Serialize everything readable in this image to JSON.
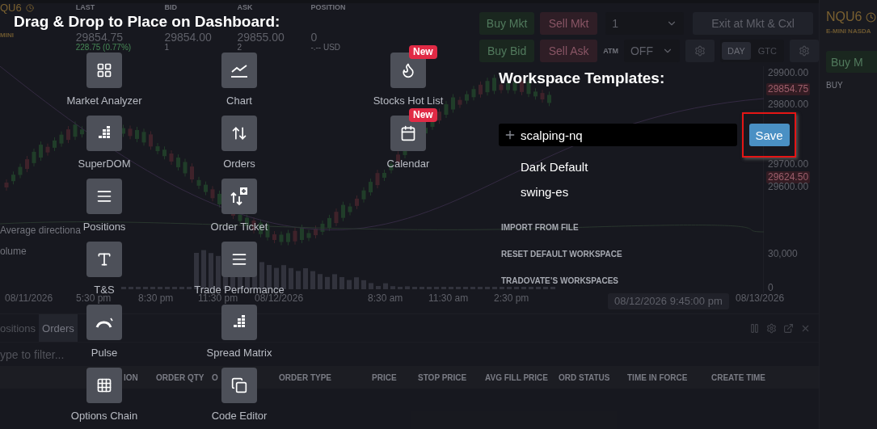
{
  "quote": {
    "symbol": "QU6",
    "subtitle": "MINI",
    "fields": [
      {
        "label": "LAST",
        "value": "29854.75",
        "change": "228.75 (0.77%)",
        "rising": true
      },
      {
        "label": "BID",
        "value": "29854.00",
        "change": "1",
        "rising": false
      },
      {
        "label": "ASK",
        "value": "29855.00",
        "change": "2",
        "rising": false
      },
      {
        "label": "POSITION",
        "value": "0",
        "change": "-.-- USD",
        "rising": false
      }
    ]
  },
  "order_bar": {
    "buy_market": "Buy Mkt",
    "sell_market": "Sell Mkt",
    "quantity": "1",
    "exit": "Exit at Mkt & Cxl",
    "buy_bid": "Buy Bid",
    "sell_ask": "Sell Ask",
    "atm_label": "ATM",
    "atm_value": "OFF",
    "time_in_force": [
      {
        "label": "DAY",
        "selected": true
      },
      {
        "label": "GTC",
        "selected": false
      }
    ]
  },
  "right_panel": {
    "symbol": "NQU6",
    "subtitle": "E-MINI NASDA",
    "buy_button": "Buy M",
    "column": "BUY"
  },
  "chart": {
    "indicator_labels": [
      "Average directiona",
      "olume"
    ],
    "y_labels": [
      {
        "text": "29900.00",
        "kind": "tick"
      },
      {
        "text": "29854.75",
        "kind": "marker"
      },
      {
        "text": "29800.00",
        "kind": "tick"
      },
      {
        "text": "29700.00",
        "kind": "tick"
      },
      {
        "text": "29624.50",
        "kind": "marker"
      },
      {
        "text": "29600.00",
        "kind": "tick"
      },
      {
        "text": "30,000",
        "kind": "tick"
      },
      {
        "text": "0",
        "kind": "tick"
      }
    ],
    "x_labels": [
      "08/11/2026",
      "5:30 pm",
      "8:30 pm",
      "11:30 pm",
      "08/12/2026",
      "8:30 am",
      "11:30 am",
      "2:30 pm"
    ],
    "crosshair_time": "08/12/2026 9:45:00 pm",
    "x_end_label": "08/13/2026"
  },
  "orders_panel": {
    "tabs": [
      {
        "label": "ositions",
        "selected": false
      },
      {
        "label": "Orders",
        "selected": true
      }
    ],
    "filter_placeholder": "ype to filter...",
    "columns": [
      "ION",
      "ORDER QTY",
      "O",
      "ORDER TYPE",
      "PRICE",
      "STOP PRICE",
      "AVG FILL PRICE",
      "ORD STATUS",
      "TIME IN FORCE",
      "CREATE TIME"
    ]
  },
  "dashboard_picker": {
    "title": "Drag & Drop to Place on Dashboard:",
    "columns": [
      [
        {
          "label": "Market Analyzer"
        },
        {
          "label": "SuperDOM"
        },
        {
          "label": "Positions"
        },
        {
          "label": "T&S"
        },
        {
          "label": "Pulse"
        },
        {
          "label": "Options Chain"
        }
      ],
      [
        {
          "label": "Chart"
        },
        {
          "label": "Orders"
        },
        {
          "label": "Order Ticket"
        },
        {
          "label": "Trade Performance"
        },
        {
          "label": "Spread Matrix"
        },
        {
          "label": "Code Editor"
        }
      ],
      [
        {
          "label": "Stocks Hot List",
          "badge": "New"
        },
        {
          "label": "Calendar",
          "badge": "New"
        }
      ]
    ]
  },
  "workspace_templates": {
    "title": "Workspace Templates:",
    "name_field": {
      "value": "scalping-nq"
    },
    "save_button": "Save",
    "save_highlighted": true,
    "templates": [
      "Dark Default",
      "swing-es"
    ],
    "actions": [
      "IMPORT FROM FILE",
      "RESET DEFAULT WORKSPACE",
      "TRADOVATE’S WORKSPACES"
    ]
  }
}
